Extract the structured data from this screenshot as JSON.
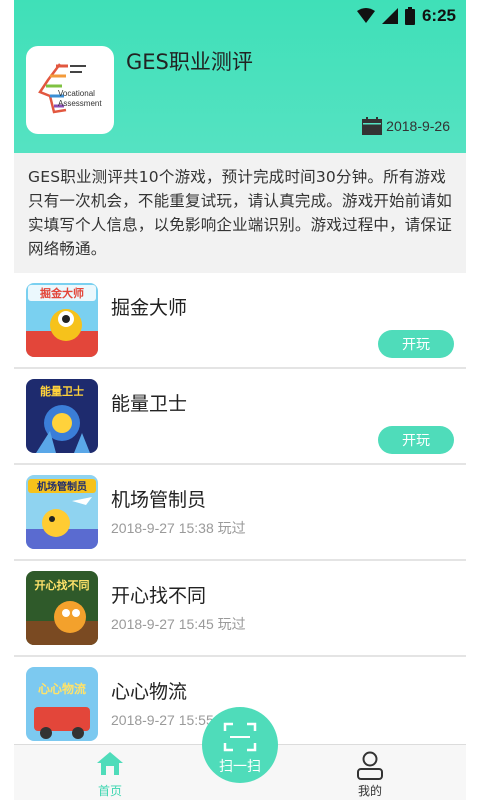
{
  "status_bar": {
    "time": "6:25"
  },
  "app": {
    "title": "GES职业测评",
    "date": "2018-9-26",
    "logo_text_line1": "Vocational",
    "logo_text_line2": "Assessment",
    "description": "GES职业测评共10个游戏，预计完成时间30分钟。所有游戏只有一次机会，不能重复试玩，请认真完成。游戏开始前请如实填写个人信息，以免影响企业端识别。游戏过程中，请保证网络畅通。"
  },
  "games": [
    {
      "name": "掘金大师",
      "button": "开玩",
      "thumb_title": "掘金大师"
    },
    {
      "name": "能量卫士",
      "button": "开玩",
      "thumb_title": "能量卫士"
    },
    {
      "name": "机场管制员",
      "played": "2018-9-27 15:38 玩过",
      "thumb_title": "机场管制员"
    },
    {
      "name": "开心找不同",
      "played": "2018-9-27 15:45 玩过",
      "thumb_title": "开心找不同"
    },
    {
      "name": "心心物流",
      "played": "2018-9-27 15:55 玩过",
      "thumb_title": "心心物流"
    }
  ],
  "tabbar": {
    "home": "首页",
    "scan": "扫一扫",
    "mine": "我的"
  },
  "colors": {
    "accent": "#4fdcba",
    "header_top": "#3fe0b8"
  }
}
